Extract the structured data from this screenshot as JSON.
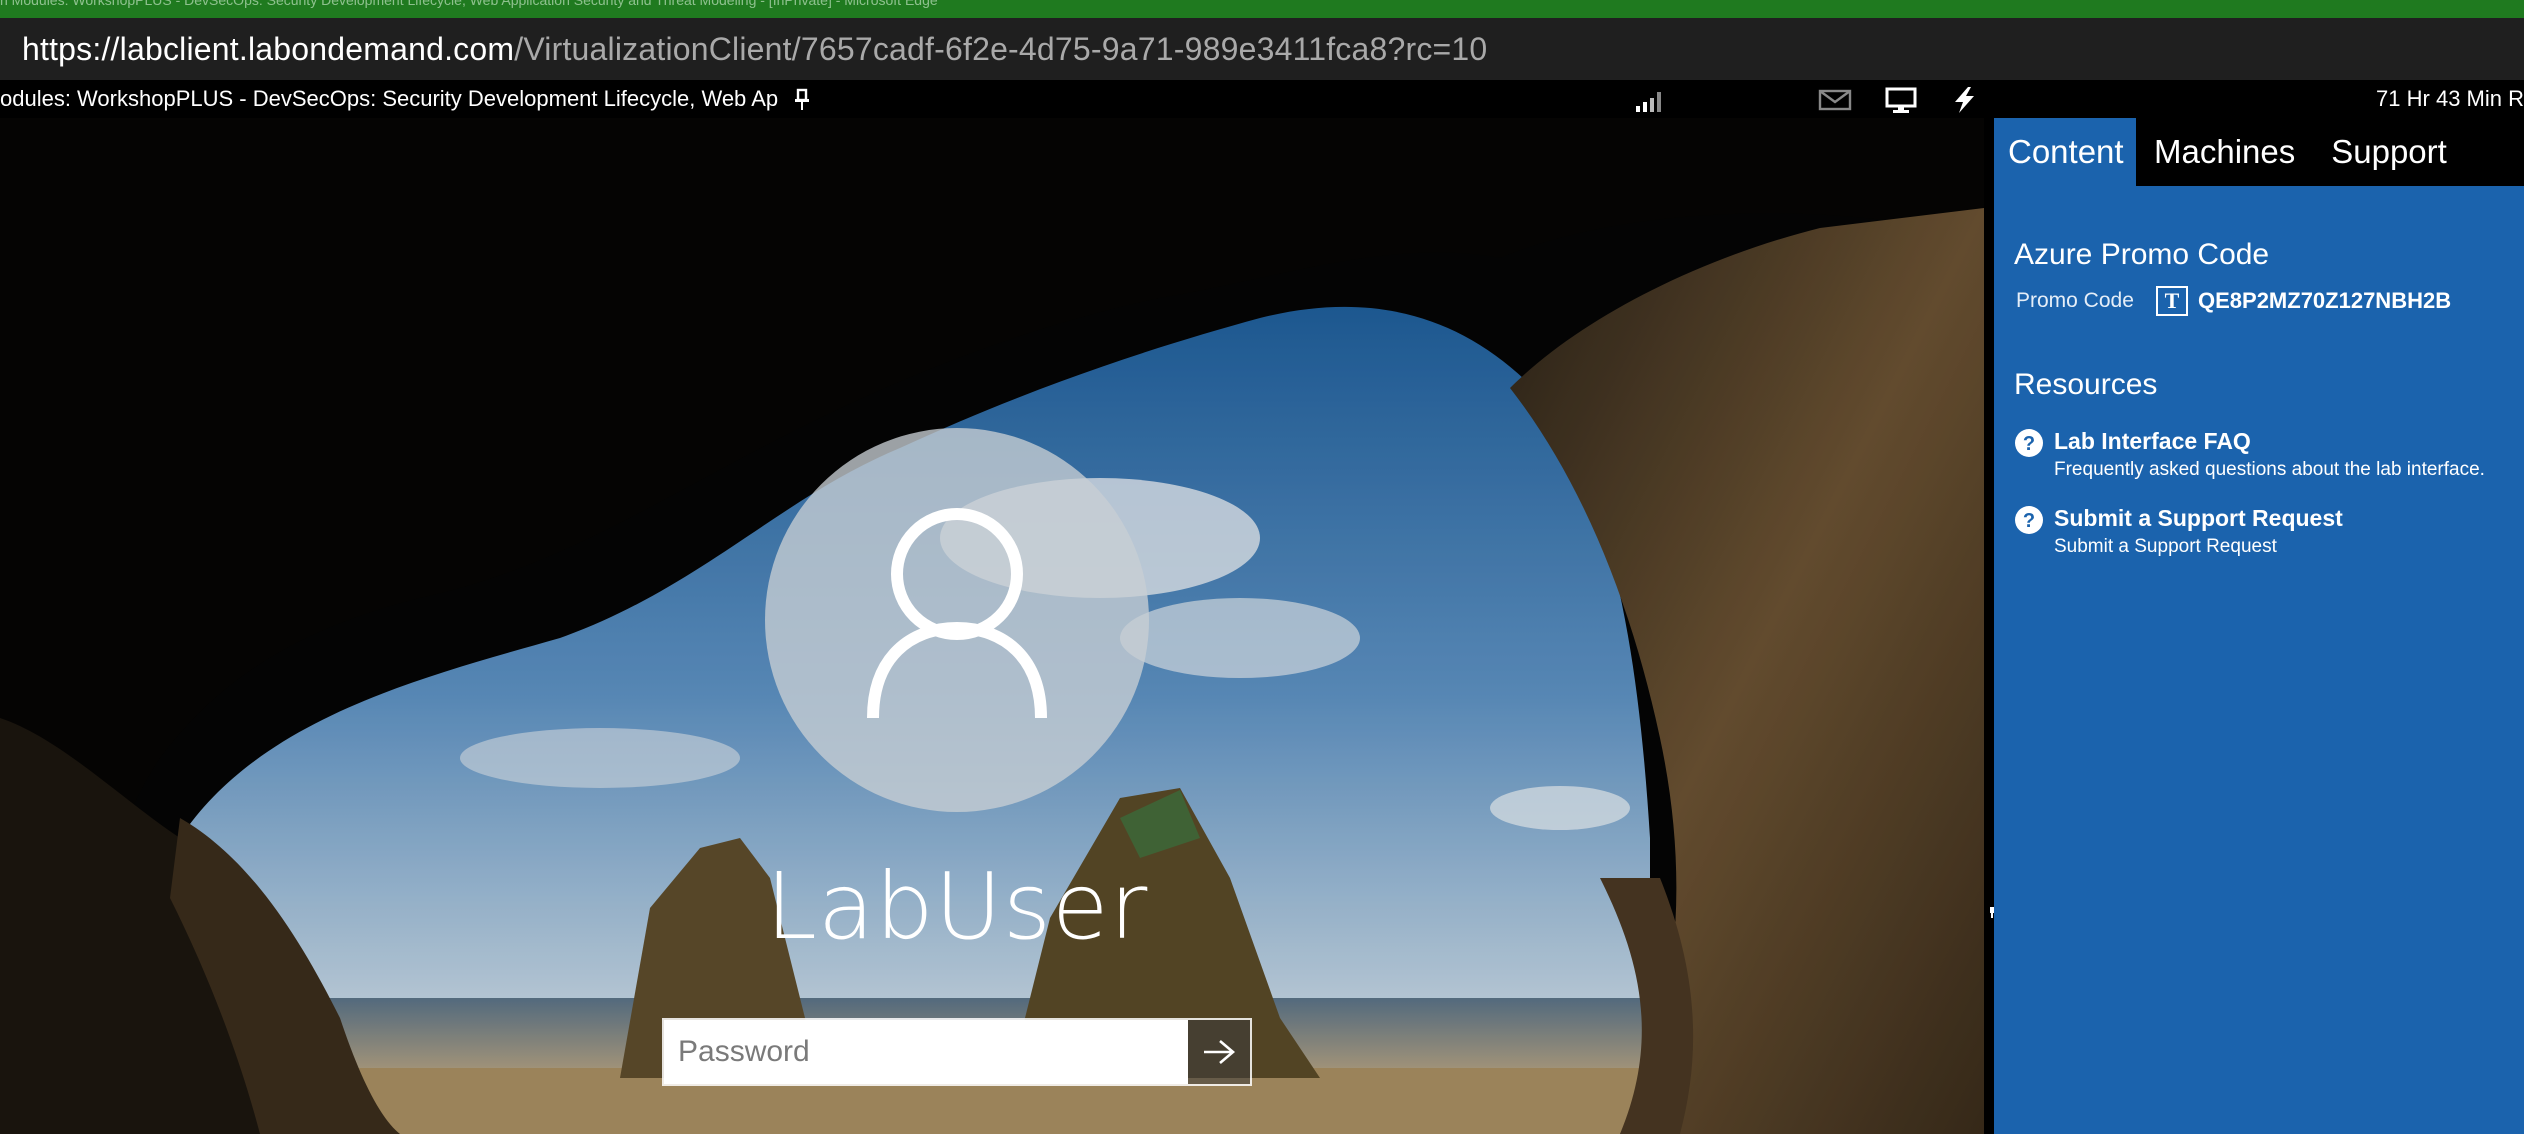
{
  "browser": {
    "window_title": "n Modules: WorkshopPLUS - DevSecOps: Security Development Lifecycle, Web Application Security and Threat Modeling - [InPrivate] - Microsoft Edge",
    "url_host": "https://labclient.labondemand.com",
    "url_path": "/VirtualizationClient/7657cadf-6f2e-4d75-9a71-989e3411fca8?rc=10",
    "title_bar_color": "#1f7a1f"
  },
  "lab_toolbar": {
    "title": "odules: WorkshopPLUS - DevSecOps: Security Development Lifecycle, Web Ap",
    "timer": "71 Hr 43 Min R",
    "icons": [
      "pin-icon",
      "signal-strength-icon",
      "mail-icon",
      "monitor-icon",
      "power-icon"
    ]
  },
  "login_screen": {
    "username": "LabUser",
    "password_placeholder": "Password",
    "submit_icon": "arrow-right-icon"
  },
  "side_panel": {
    "accent_color": "#1b63ad",
    "tabs": [
      {
        "label": "Content",
        "active": true
      },
      {
        "label": "Machines",
        "active": false
      },
      {
        "label": "Support",
        "active": false
      }
    ],
    "promo": {
      "heading": "Azure Promo Code",
      "label": "Promo Code",
      "type_icon_text": "T",
      "value": "QE8P2MZ70Z127NBH2B"
    },
    "resources": {
      "heading": "Resources",
      "items": [
        {
          "title": "Lab Interface FAQ",
          "description": "Frequently asked questions about the lab interface."
        },
        {
          "title": "Submit a Support Request",
          "description": "Submit a Support Request"
        }
      ]
    }
  }
}
